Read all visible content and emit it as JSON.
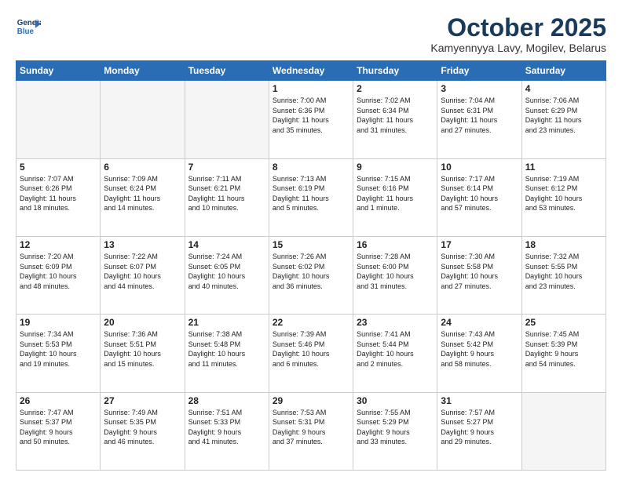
{
  "logo": {
    "line1": "General",
    "line2": "Blue"
  },
  "title": "October 2025",
  "subtitle": "Kamyennyya Lavy, Mogilev, Belarus",
  "weekdays": [
    "Sunday",
    "Monday",
    "Tuesday",
    "Wednesday",
    "Thursday",
    "Friday",
    "Saturday"
  ],
  "weeks": [
    [
      {
        "day": "",
        "info": ""
      },
      {
        "day": "",
        "info": ""
      },
      {
        "day": "",
        "info": ""
      },
      {
        "day": "1",
        "info": "Sunrise: 7:00 AM\nSunset: 6:36 PM\nDaylight: 11 hours\nand 35 minutes."
      },
      {
        "day": "2",
        "info": "Sunrise: 7:02 AM\nSunset: 6:34 PM\nDaylight: 11 hours\nand 31 minutes."
      },
      {
        "day": "3",
        "info": "Sunrise: 7:04 AM\nSunset: 6:31 PM\nDaylight: 11 hours\nand 27 minutes."
      },
      {
        "day": "4",
        "info": "Sunrise: 7:06 AM\nSunset: 6:29 PM\nDaylight: 11 hours\nand 23 minutes."
      }
    ],
    [
      {
        "day": "5",
        "info": "Sunrise: 7:07 AM\nSunset: 6:26 PM\nDaylight: 11 hours\nand 18 minutes."
      },
      {
        "day": "6",
        "info": "Sunrise: 7:09 AM\nSunset: 6:24 PM\nDaylight: 11 hours\nand 14 minutes."
      },
      {
        "day": "7",
        "info": "Sunrise: 7:11 AM\nSunset: 6:21 PM\nDaylight: 11 hours\nand 10 minutes."
      },
      {
        "day": "8",
        "info": "Sunrise: 7:13 AM\nSunset: 6:19 PM\nDaylight: 11 hours\nand 5 minutes."
      },
      {
        "day": "9",
        "info": "Sunrise: 7:15 AM\nSunset: 6:16 PM\nDaylight: 11 hours\nand 1 minute."
      },
      {
        "day": "10",
        "info": "Sunrise: 7:17 AM\nSunset: 6:14 PM\nDaylight: 10 hours\nand 57 minutes."
      },
      {
        "day": "11",
        "info": "Sunrise: 7:19 AM\nSunset: 6:12 PM\nDaylight: 10 hours\nand 53 minutes."
      }
    ],
    [
      {
        "day": "12",
        "info": "Sunrise: 7:20 AM\nSunset: 6:09 PM\nDaylight: 10 hours\nand 48 minutes."
      },
      {
        "day": "13",
        "info": "Sunrise: 7:22 AM\nSunset: 6:07 PM\nDaylight: 10 hours\nand 44 minutes."
      },
      {
        "day": "14",
        "info": "Sunrise: 7:24 AM\nSunset: 6:05 PM\nDaylight: 10 hours\nand 40 minutes."
      },
      {
        "day": "15",
        "info": "Sunrise: 7:26 AM\nSunset: 6:02 PM\nDaylight: 10 hours\nand 36 minutes."
      },
      {
        "day": "16",
        "info": "Sunrise: 7:28 AM\nSunset: 6:00 PM\nDaylight: 10 hours\nand 31 minutes."
      },
      {
        "day": "17",
        "info": "Sunrise: 7:30 AM\nSunset: 5:58 PM\nDaylight: 10 hours\nand 27 minutes."
      },
      {
        "day": "18",
        "info": "Sunrise: 7:32 AM\nSunset: 5:55 PM\nDaylight: 10 hours\nand 23 minutes."
      }
    ],
    [
      {
        "day": "19",
        "info": "Sunrise: 7:34 AM\nSunset: 5:53 PM\nDaylight: 10 hours\nand 19 minutes."
      },
      {
        "day": "20",
        "info": "Sunrise: 7:36 AM\nSunset: 5:51 PM\nDaylight: 10 hours\nand 15 minutes."
      },
      {
        "day": "21",
        "info": "Sunrise: 7:38 AM\nSunset: 5:48 PM\nDaylight: 10 hours\nand 11 minutes."
      },
      {
        "day": "22",
        "info": "Sunrise: 7:39 AM\nSunset: 5:46 PM\nDaylight: 10 hours\nand 6 minutes."
      },
      {
        "day": "23",
        "info": "Sunrise: 7:41 AM\nSunset: 5:44 PM\nDaylight: 10 hours\nand 2 minutes."
      },
      {
        "day": "24",
        "info": "Sunrise: 7:43 AM\nSunset: 5:42 PM\nDaylight: 9 hours\nand 58 minutes."
      },
      {
        "day": "25",
        "info": "Sunrise: 7:45 AM\nSunset: 5:39 PM\nDaylight: 9 hours\nand 54 minutes."
      }
    ],
    [
      {
        "day": "26",
        "info": "Sunrise: 7:47 AM\nSunset: 5:37 PM\nDaylight: 9 hours\nand 50 minutes."
      },
      {
        "day": "27",
        "info": "Sunrise: 7:49 AM\nSunset: 5:35 PM\nDaylight: 9 hours\nand 46 minutes."
      },
      {
        "day": "28",
        "info": "Sunrise: 7:51 AM\nSunset: 5:33 PM\nDaylight: 9 hours\nand 41 minutes."
      },
      {
        "day": "29",
        "info": "Sunrise: 7:53 AM\nSunset: 5:31 PM\nDaylight: 9 hours\nand 37 minutes."
      },
      {
        "day": "30",
        "info": "Sunrise: 7:55 AM\nSunset: 5:29 PM\nDaylight: 9 hours\nand 33 minutes."
      },
      {
        "day": "31",
        "info": "Sunrise: 7:57 AM\nSunset: 5:27 PM\nDaylight: 9 hours\nand 29 minutes."
      },
      {
        "day": "",
        "info": ""
      }
    ]
  ]
}
